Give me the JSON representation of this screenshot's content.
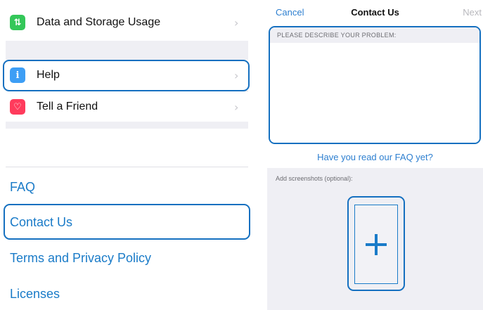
{
  "settings": {
    "items": [
      {
        "label": "Data and Storage Usage",
        "icon": "arrows-up-down-icon",
        "color": "#34c759"
      },
      {
        "label": "Help",
        "icon": "info-icon",
        "color": "#3d9ef5"
      },
      {
        "label": "Tell a Friend",
        "icon": "heart-icon",
        "color": "#ff3b5c"
      }
    ]
  },
  "links": {
    "faq": "FAQ",
    "contact": "Contact Us",
    "terms": "Terms and Privacy Policy",
    "licenses": "Licenses"
  },
  "contact_form": {
    "cancel": "Cancel",
    "title": "Contact Us",
    "next": "Next",
    "problem_header": "PLEASE DESCRIBE YOUR PROBLEM:",
    "faq_prompt": "Have you read our FAQ yet?",
    "screenshots_label": "Add screenshots (optional):"
  },
  "colors": {
    "accent": "#2d7fd0",
    "highlight": "#1570c0",
    "group_bg": "#efeff4"
  }
}
